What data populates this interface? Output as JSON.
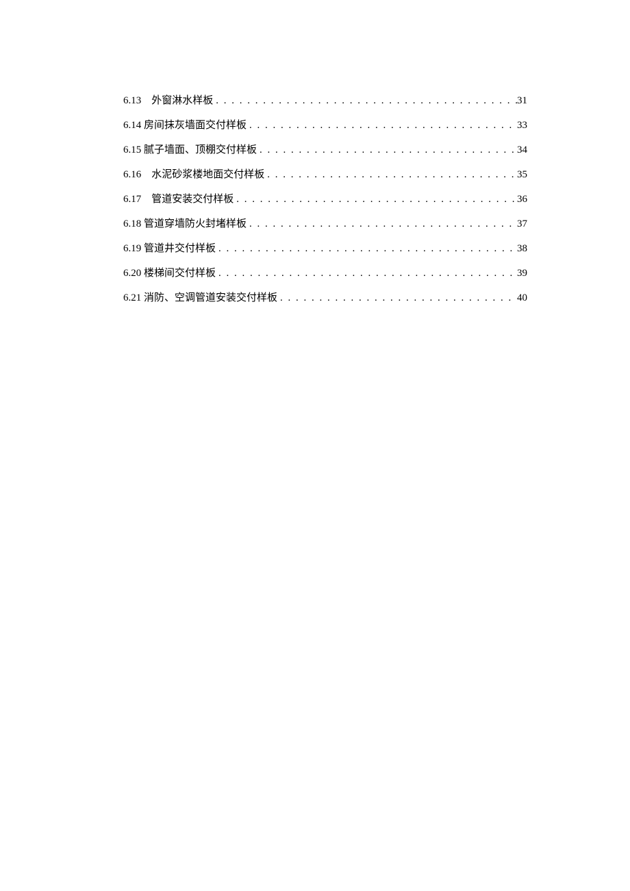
{
  "toc": {
    "entries": [
      {
        "number": "6.13",
        "gap": "    ",
        "title": "外窗淋水样板",
        "page": "31"
      },
      {
        "number": "6.14",
        "gap": " ",
        "title": "房间抹灰墙面交付样板",
        "page": "33"
      },
      {
        "number": "6.15",
        "gap": " ",
        "title": "腻子墙面、顶棚交付样板",
        "page": "34"
      },
      {
        "number": "6.16",
        "gap": "    ",
        "title": "水泥砂浆楼地面交付样板",
        "page": "35"
      },
      {
        "number": "6.17",
        "gap": "    ",
        "title": "管道安装交付样板",
        "page": "36"
      },
      {
        "number": "6.18",
        "gap": " ",
        "title": "管道穿墙防火封堵样板",
        "page": "37"
      },
      {
        "number": "6.19",
        "gap": " ",
        "title": "管道井交付样板",
        "page": "38"
      },
      {
        "number": "6.20",
        "gap": " ",
        "title": "楼梯间交付样板",
        "page": "39"
      },
      {
        "number": "6.21",
        "gap": " ",
        "title": "消防、空调管道安装交付样板",
        "page": "40"
      }
    ]
  }
}
